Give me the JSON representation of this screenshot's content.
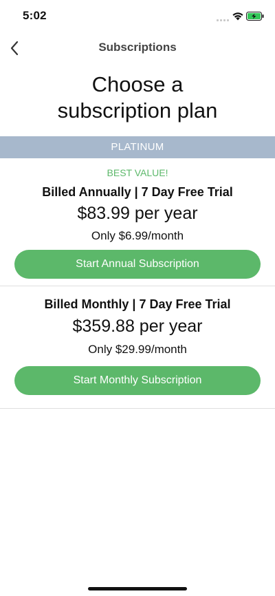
{
  "status_bar": {
    "time": "5:02",
    "icons": [
      "signal-icon",
      "wifi-icon",
      "battery-charging-icon"
    ],
    "battery_color": "#34c759"
  },
  "nav": {
    "title": "Subscriptions",
    "back_icon": "chevron-left-icon"
  },
  "heading": {
    "line1": "Choose a",
    "line2": "subscription plan"
  },
  "tier": {
    "label": "PLATINUM",
    "color": "#a7b8cc"
  },
  "plans": [
    {
      "badge": "BEST VALUE!",
      "title": "Billed Annually | 7 Day Free Trial",
      "price": "$83.99 per year",
      "monthly": "Only $6.99/month",
      "button_label": "Start Annual Subscription"
    },
    {
      "title": "Billed Monthly | 7 Day Free Trial",
      "price": "$359.88 per year",
      "monthly": "Only $29.99/month",
      "button_label": "Start Monthly Subscription"
    }
  ],
  "colors": {
    "accent_green": "#5cb86a",
    "divider": "#dedede"
  }
}
